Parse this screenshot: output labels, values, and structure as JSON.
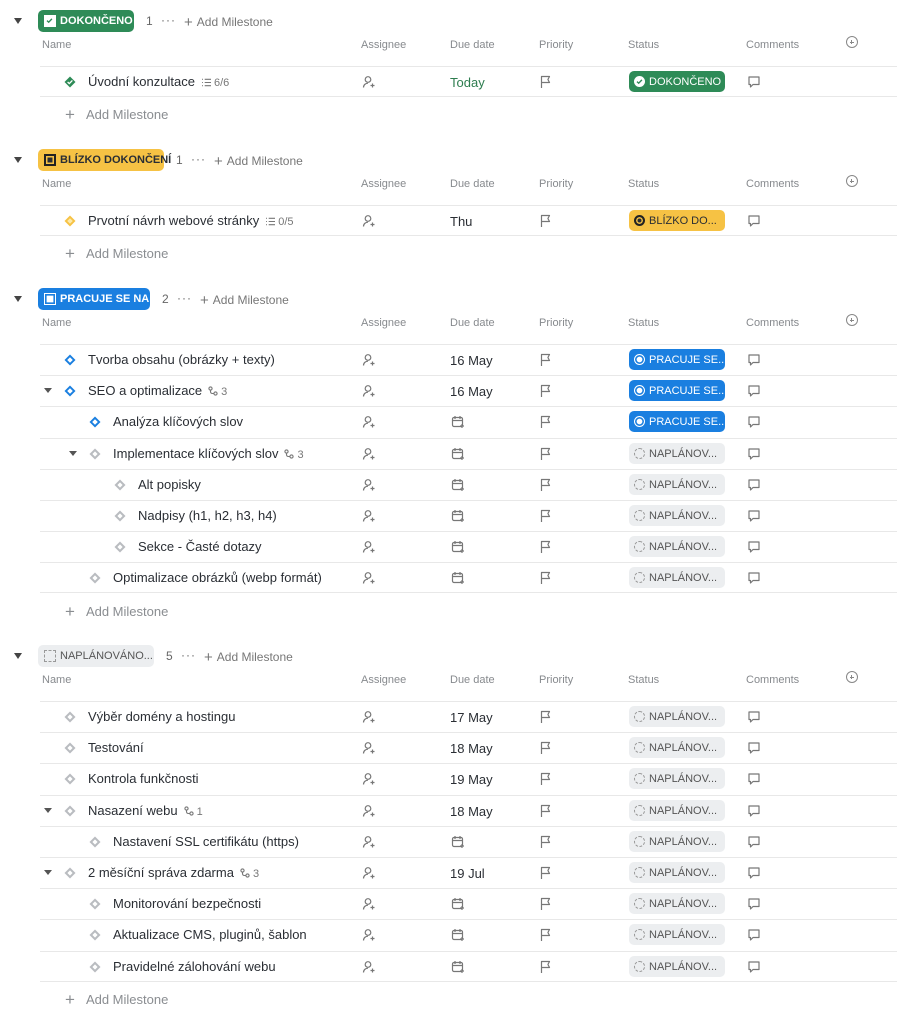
{
  "columns": {
    "name": "Name",
    "assignee": "Assignee",
    "due": "Due date",
    "priority": "Priority",
    "status": "Status",
    "comments": "Comments"
  },
  "add_milestone": "Add Milestone",
  "colors": {
    "done": "#2e8b57",
    "near": "#f6c244",
    "work": "#1a7fe0",
    "plan": "#eceef0"
  },
  "groups": [
    {
      "status": "DOKONČENO",
      "count": "1",
      "tasks": [
        {
          "name": "Úvodní konzultace",
          "meta": "6/6",
          "due": "Today",
          "status": "DOKONČENO"
        }
      ]
    },
    {
      "status": "BLÍZKO DOKONČENÍ",
      "count": "1",
      "tasks": [
        {
          "name": "Prvotní návrh webové stránky",
          "meta": "0/5",
          "due": "Thu",
          "status": "BLÍZKO DO..."
        }
      ]
    },
    {
      "status": "PRACUJE SE NA...",
      "count": "2",
      "tasks": [
        {
          "name": "Tvorba obsahu (obrázky + texty)",
          "due": "16 May",
          "status": "PRACUJE SE..."
        },
        {
          "name": "SEO a optimalizace",
          "meta": "3",
          "due": "16 May",
          "status": "PRACUJE SE..."
        },
        {
          "name": "Analýza klíčových slov",
          "status": "PRACUJE SE..."
        },
        {
          "name": "Implementace klíčových slov",
          "meta": "3",
          "status": "NAPLÁNOV..."
        },
        {
          "name": "Alt popisky",
          "status": "NAPLÁNOV..."
        },
        {
          "name": "Nadpisy (h1, h2, h3, h4)",
          "status": "NAPLÁNOV..."
        },
        {
          "name": "Sekce - Časté dotazy",
          "status": "NAPLÁNOV..."
        },
        {
          "name": "Optimalizace obrázků (webp formát)",
          "status": "NAPLÁNOV..."
        }
      ]
    },
    {
      "status": "NAPLÁNOVÁNO...",
      "count": "5",
      "tasks": [
        {
          "name": "Výběr domény a hostingu",
          "due": "17 May",
          "status": "NAPLÁNOV..."
        },
        {
          "name": "Testování",
          "due": "18 May",
          "status": "NAPLÁNOV..."
        },
        {
          "name": "Kontrola funkčnosti",
          "due": "19 May",
          "status": "NAPLÁNOV..."
        },
        {
          "name": "Nasazení webu",
          "meta": "1",
          "due": "18 May",
          "status": "NAPLÁNOV..."
        },
        {
          "name": "Nastavení SSL certifikátu (https)",
          "status": "NAPLÁNOV..."
        },
        {
          "name": "2 měsíční správa zdarma",
          "meta": "3",
          "due": "19 Jul",
          "status": "NAPLÁNOV..."
        },
        {
          "name": "Monitorování bezpečnosti",
          "status": "NAPLÁNOV..."
        },
        {
          "name": "Aktualizace CMS, pluginů, šablon",
          "status": "NAPLÁNOV..."
        },
        {
          "name": "Pravidelné zálohování webu",
          "status": "NAPLÁNOV..."
        }
      ]
    }
  ]
}
